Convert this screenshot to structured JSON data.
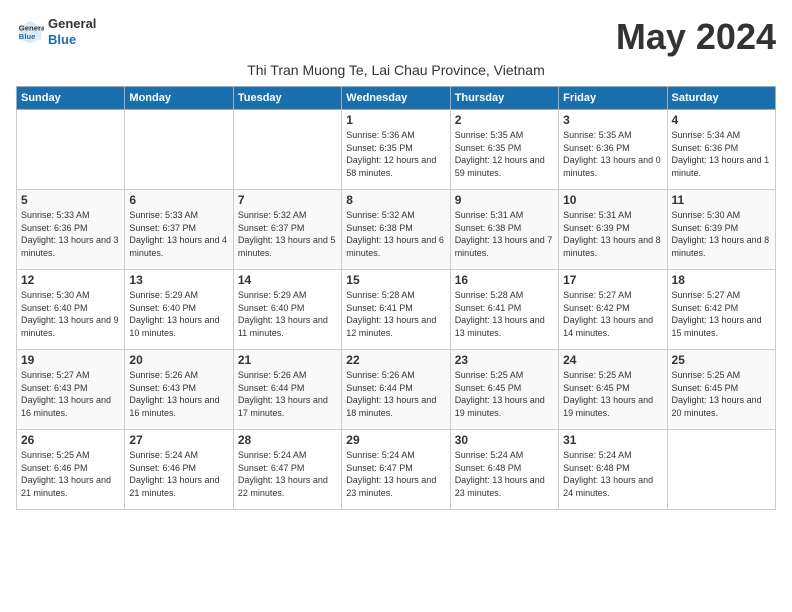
{
  "logo": {
    "line1": "General",
    "line2": "Blue"
  },
  "title": "May 2024",
  "subtitle": "Thi Tran Muong Te, Lai Chau Province, Vietnam",
  "days_of_week": [
    "Sunday",
    "Monday",
    "Tuesday",
    "Wednesday",
    "Thursday",
    "Friday",
    "Saturday"
  ],
  "weeks": [
    [
      {
        "day": "",
        "info": ""
      },
      {
        "day": "",
        "info": ""
      },
      {
        "day": "",
        "info": ""
      },
      {
        "day": "1",
        "info": "Sunrise: 5:36 AM\nSunset: 6:35 PM\nDaylight: 12 hours and 58 minutes."
      },
      {
        "day": "2",
        "info": "Sunrise: 5:35 AM\nSunset: 6:35 PM\nDaylight: 12 hours and 59 minutes."
      },
      {
        "day": "3",
        "info": "Sunrise: 5:35 AM\nSunset: 6:36 PM\nDaylight: 13 hours and 0 minutes."
      },
      {
        "day": "4",
        "info": "Sunrise: 5:34 AM\nSunset: 6:36 PM\nDaylight: 13 hours and 1 minute."
      }
    ],
    [
      {
        "day": "5",
        "info": "Sunrise: 5:33 AM\nSunset: 6:36 PM\nDaylight: 13 hours and 3 minutes."
      },
      {
        "day": "6",
        "info": "Sunrise: 5:33 AM\nSunset: 6:37 PM\nDaylight: 13 hours and 4 minutes."
      },
      {
        "day": "7",
        "info": "Sunrise: 5:32 AM\nSunset: 6:37 PM\nDaylight: 13 hours and 5 minutes."
      },
      {
        "day": "8",
        "info": "Sunrise: 5:32 AM\nSunset: 6:38 PM\nDaylight: 13 hours and 6 minutes."
      },
      {
        "day": "9",
        "info": "Sunrise: 5:31 AM\nSunset: 6:38 PM\nDaylight: 13 hours and 7 minutes."
      },
      {
        "day": "10",
        "info": "Sunrise: 5:31 AM\nSunset: 6:39 PM\nDaylight: 13 hours and 8 minutes."
      },
      {
        "day": "11",
        "info": "Sunrise: 5:30 AM\nSunset: 6:39 PM\nDaylight: 13 hours and 8 minutes."
      }
    ],
    [
      {
        "day": "12",
        "info": "Sunrise: 5:30 AM\nSunset: 6:40 PM\nDaylight: 13 hours and 9 minutes."
      },
      {
        "day": "13",
        "info": "Sunrise: 5:29 AM\nSunset: 6:40 PM\nDaylight: 13 hours and 10 minutes."
      },
      {
        "day": "14",
        "info": "Sunrise: 5:29 AM\nSunset: 6:40 PM\nDaylight: 13 hours and 11 minutes."
      },
      {
        "day": "15",
        "info": "Sunrise: 5:28 AM\nSunset: 6:41 PM\nDaylight: 13 hours and 12 minutes."
      },
      {
        "day": "16",
        "info": "Sunrise: 5:28 AM\nSunset: 6:41 PM\nDaylight: 13 hours and 13 minutes."
      },
      {
        "day": "17",
        "info": "Sunrise: 5:27 AM\nSunset: 6:42 PM\nDaylight: 13 hours and 14 minutes."
      },
      {
        "day": "18",
        "info": "Sunrise: 5:27 AM\nSunset: 6:42 PM\nDaylight: 13 hours and 15 minutes."
      }
    ],
    [
      {
        "day": "19",
        "info": "Sunrise: 5:27 AM\nSunset: 6:43 PM\nDaylight: 13 hours and 16 minutes."
      },
      {
        "day": "20",
        "info": "Sunrise: 5:26 AM\nSunset: 6:43 PM\nDaylight: 13 hours and 16 minutes."
      },
      {
        "day": "21",
        "info": "Sunrise: 5:26 AM\nSunset: 6:44 PM\nDaylight: 13 hours and 17 minutes."
      },
      {
        "day": "22",
        "info": "Sunrise: 5:26 AM\nSunset: 6:44 PM\nDaylight: 13 hours and 18 minutes."
      },
      {
        "day": "23",
        "info": "Sunrise: 5:25 AM\nSunset: 6:45 PM\nDaylight: 13 hours and 19 minutes."
      },
      {
        "day": "24",
        "info": "Sunrise: 5:25 AM\nSunset: 6:45 PM\nDaylight: 13 hours and 19 minutes."
      },
      {
        "day": "25",
        "info": "Sunrise: 5:25 AM\nSunset: 6:45 PM\nDaylight: 13 hours and 20 minutes."
      }
    ],
    [
      {
        "day": "26",
        "info": "Sunrise: 5:25 AM\nSunset: 6:46 PM\nDaylight: 13 hours and 21 minutes."
      },
      {
        "day": "27",
        "info": "Sunrise: 5:24 AM\nSunset: 6:46 PM\nDaylight: 13 hours and 21 minutes."
      },
      {
        "day": "28",
        "info": "Sunrise: 5:24 AM\nSunset: 6:47 PM\nDaylight: 13 hours and 22 minutes."
      },
      {
        "day": "29",
        "info": "Sunrise: 5:24 AM\nSunset: 6:47 PM\nDaylight: 13 hours and 23 minutes."
      },
      {
        "day": "30",
        "info": "Sunrise: 5:24 AM\nSunset: 6:48 PM\nDaylight: 13 hours and 23 minutes."
      },
      {
        "day": "31",
        "info": "Sunrise: 5:24 AM\nSunset: 6:48 PM\nDaylight: 13 hours and 24 minutes."
      },
      {
        "day": "",
        "info": ""
      }
    ]
  ]
}
